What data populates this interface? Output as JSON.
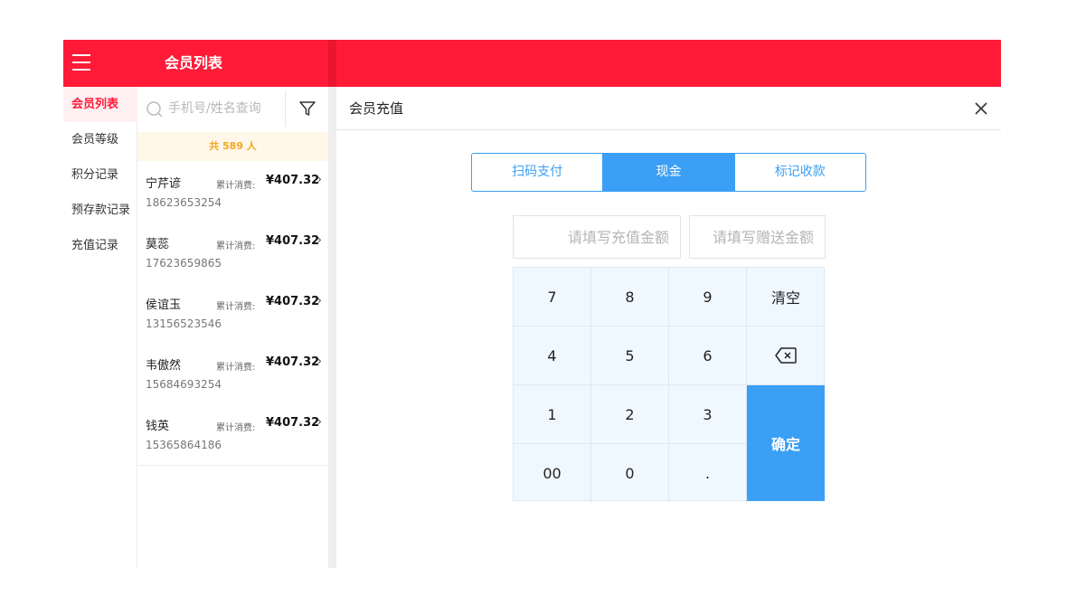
{
  "header": {
    "title": "会员列表"
  },
  "sidebar": {
    "items": [
      {
        "label": "会员列表",
        "active": true
      },
      {
        "label": "会员等级",
        "active": false
      },
      {
        "label": "积分记录",
        "active": false
      },
      {
        "label": "预存款记录",
        "active": false
      },
      {
        "label": "充值记录",
        "active": false
      }
    ]
  },
  "search": {
    "placeholder": "手机号/姓名查询",
    "value": ""
  },
  "count_text": "共 589 人",
  "members": [
    {
      "name": "宁芹谚",
      "label": "累计消费:",
      "amount": "¥407.32",
      "phone": "18623653254"
    },
    {
      "name": "莫蕊",
      "label": "累计消费:",
      "amount": "¥407.32",
      "phone": "17623659865"
    },
    {
      "name": "侯谊玉",
      "label": "累计消费:",
      "amount": "¥407.32",
      "phone": "13156523546"
    },
    {
      "name": "韦傲然",
      "label": "累计消费:",
      "amount": "¥407.32",
      "phone": "15684693254"
    },
    {
      "name": "钱英",
      "label": "累计消费:",
      "amount": "¥407.32",
      "phone": "15365864186"
    }
  ],
  "arrow_glyph": "›",
  "panel": {
    "title": "会员充值",
    "tabs": [
      {
        "label": "扫码支付",
        "active": false
      },
      {
        "label": "现金",
        "active": true
      },
      {
        "label": "标记收款",
        "active": false
      }
    ],
    "recharge_placeholder": "请填写充值金额",
    "gift_placeholder": "请填写赠送金额",
    "keys": {
      "k7": "7",
      "k8": "8",
      "k9": "9",
      "clear": "清空",
      "k4": "4",
      "k5": "5",
      "k6": "6",
      "k1": "1",
      "k2": "2",
      "k3": "3",
      "confirm": "确定",
      "k00": "00",
      "k0": "0",
      "dot": "."
    }
  },
  "colors": {
    "brand_red": "#ff1a38",
    "accent_blue": "#3a9ff5",
    "count_orange": "#f5a623"
  }
}
